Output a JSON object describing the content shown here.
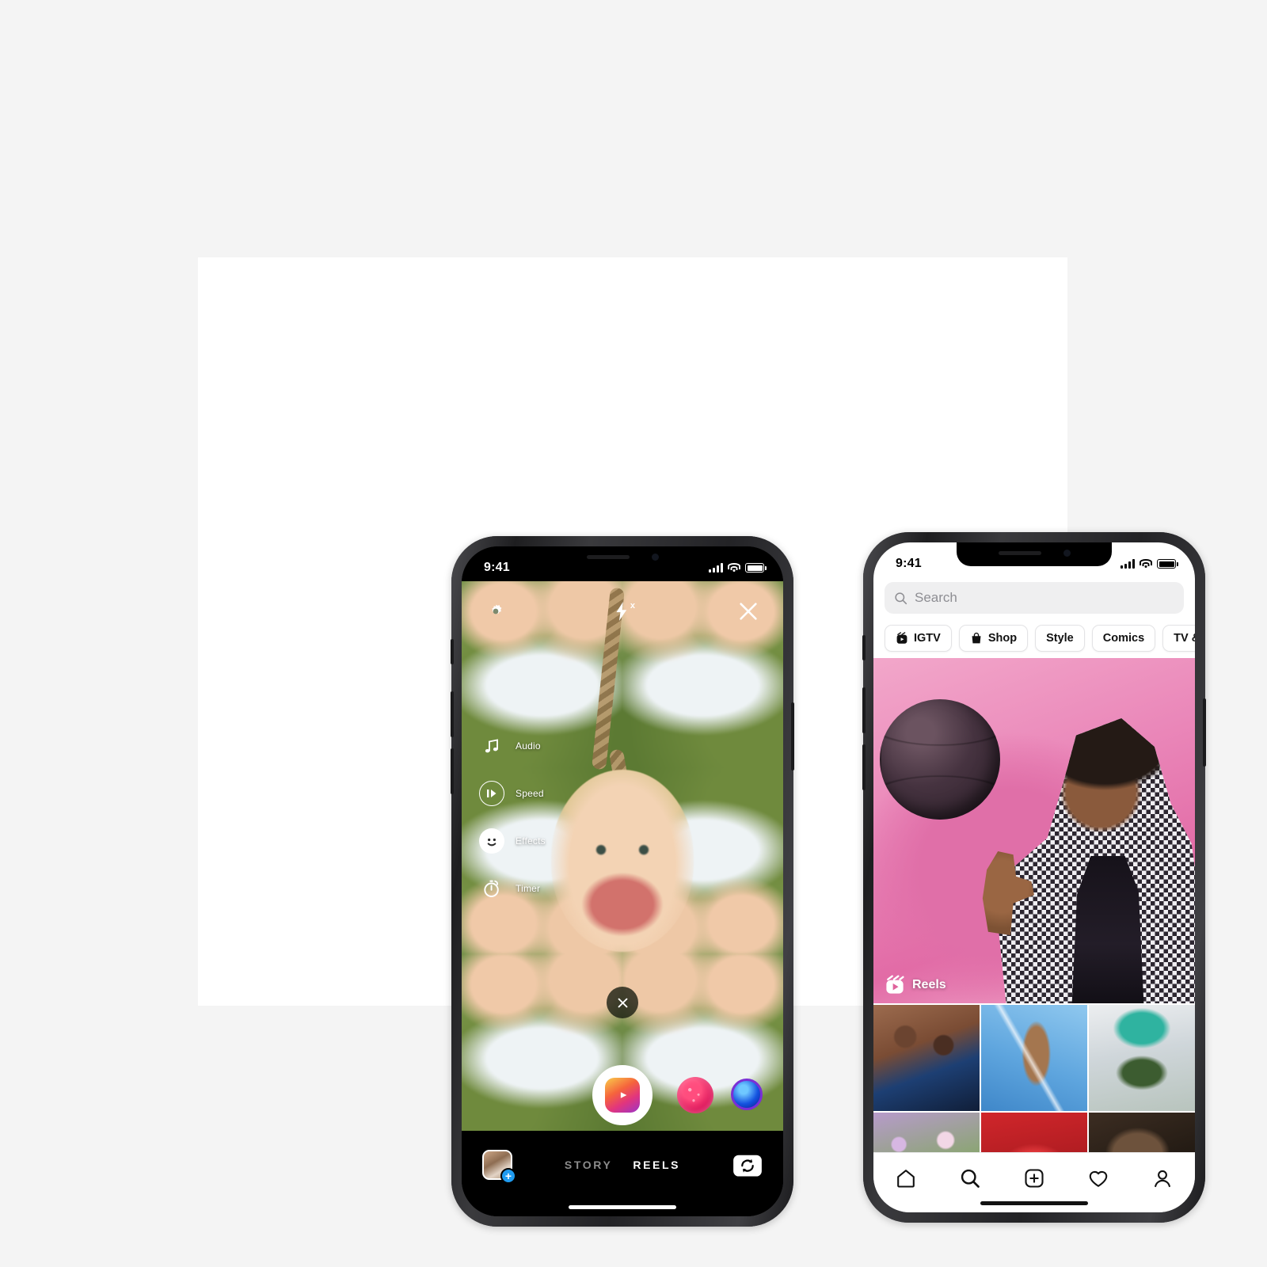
{
  "canvas": {
    "background_color": "#f4f4f4",
    "card_color": "#ffffff"
  },
  "left_phone": {
    "screen": "instagram-reels-camera",
    "status_bar": {
      "time": "9:41",
      "signal_icon": "cellular-bars-icon",
      "wifi_icon": "wifi-icon",
      "battery_icon": "battery-icon"
    },
    "top_controls": [
      {
        "name": "settings",
        "icon": "gear-icon"
      },
      {
        "name": "flash",
        "icon": "flash-off-icon",
        "badge": "x"
      },
      {
        "name": "close",
        "icon": "close-icon"
      }
    ],
    "side_menu": [
      {
        "label": "Audio",
        "icon": "music-note-icon"
      },
      {
        "label": "Speed",
        "icon": "speed-icon"
      },
      {
        "label": "Effects",
        "icon": "smiley-face-icon"
      },
      {
        "label": "Timer",
        "icon": "timer-icon"
      }
    ],
    "mid_close_icon": "close-icon",
    "shutter": {
      "name": "record-button",
      "icon": "reels-clapper-icon"
    },
    "effect_thumbs": [
      {
        "name": "effect-hearts",
        "color": "#e0185c"
      },
      {
        "name": "effect-bubble",
        "color": "#1452e0"
      }
    ],
    "bottom_bar": {
      "gallery_thumb": {
        "name": "gallery-thumbnail",
        "badge": "+"
      },
      "modes": [
        {
          "label": "STORY",
          "active": false
        },
        {
          "label": "REELS",
          "active": true
        }
      ],
      "flip_camera_icon": "flip-camera-icon"
    }
  },
  "right_phone": {
    "screen": "instagram-explore",
    "status_bar": {
      "time": "9:41",
      "signal_icon": "cellular-bars-icon",
      "wifi_icon": "wifi-icon",
      "battery_icon": "battery-icon"
    },
    "search": {
      "placeholder": "Search",
      "value": "",
      "icon": "search-icon"
    },
    "chips": [
      {
        "label": "IGTV",
        "icon": "igtv-icon"
      },
      {
        "label": "Shop",
        "icon": "shopping-bag-icon"
      },
      {
        "label": "Style",
        "icon": ""
      },
      {
        "label": "Comics",
        "icon": ""
      },
      {
        "label": "TV & Movie",
        "icon": ""
      }
    ],
    "hero": {
      "badge_label": "Reels",
      "badge_icon": "reels-clapper-icon",
      "background_color": "#e87bb0"
    },
    "grid": [
      {
        "name": "grid-cell-1",
        "colors": [
          "#7b4a33",
          "#1d3f73"
        ]
      },
      {
        "name": "grid-cell-2",
        "colors": [
          "#79b8e8",
          "#3f87c9"
        ]
      },
      {
        "name": "grid-cell-3",
        "colors": [
          "#dcdfe2",
          "#9bb3a0"
        ]
      },
      {
        "name": "grid-cell-4",
        "colors": [
          "#c9b6d8",
          "#7f9c63"
        ]
      },
      {
        "name": "grid-cell-5",
        "colors": [
          "#d0262b",
          "#8d1418"
        ]
      },
      {
        "name": "grid-cell-6",
        "colors": [
          "#4e3b2d",
          "#1a1410"
        ]
      }
    ],
    "tabbar": [
      {
        "name": "tab-home",
        "icon": "home-icon"
      },
      {
        "name": "tab-search",
        "icon": "search-icon"
      },
      {
        "name": "tab-create",
        "icon": "plus-square-icon"
      },
      {
        "name": "tab-activity",
        "icon": "heart-icon"
      },
      {
        "name": "tab-profile",
        "icon": "person-icon"
      }
    ]
  }
}
